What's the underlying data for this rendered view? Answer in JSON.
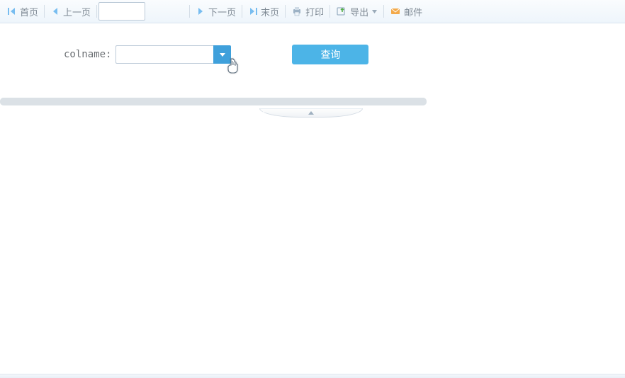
{
  "toolbar": {
    "first_label": "首页",
    "prev_label": "上一页",
    "next_label": "下一页",
    "last_label": "末页",
    "print_label": "打印",
    "export_label": "导出",
    "mail_label": "邮件",
    "page_input_value": ""
  },
  "filter": {
    "label": "colname:",
    "value": "",
    "query_label": "查询"
  },
  "colors": {
    "accent": "#4cb4e7",
    "toolbar_text": "#7e8994",
    "border": "#bccad8"
  }
}
